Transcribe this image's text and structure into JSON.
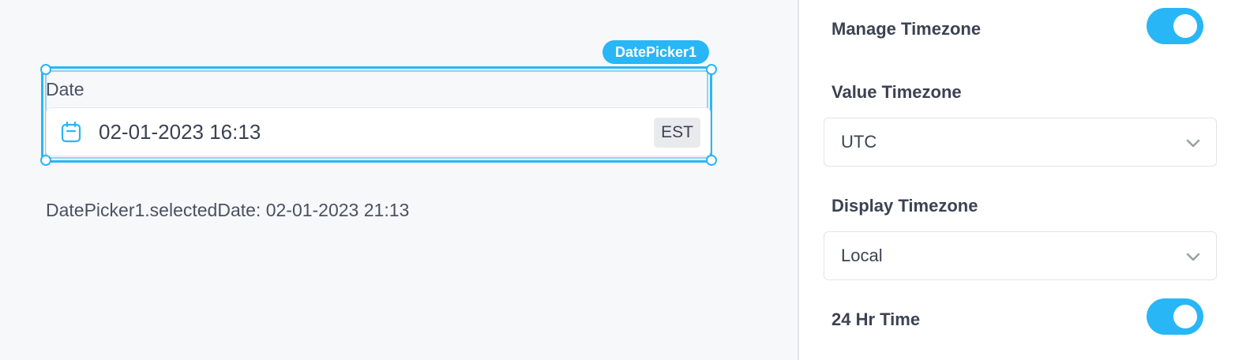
{
  "canvas": {
    "component_name": "DatePicker1",
    "date_picker": {
      "label": "Date",
      "value": "02-01-2023 16:13",
      "timezone_badge": "EST",
      "icon": "calendar-icon"
    },
    "selected_date_text": "DatePicker1.selectedDate: 02-01-2023 21:13"
  },
  "properties": {
    "manage_timezone": {
      "label": "Manage Timezone",
      "enabled": true
    },
    "value_timezone": {
      "label": "Value Timezone",
      "selected": "UTC",
      "icon": "chevron-down-icon"
    },
    "display_timezone": {
      "label": "Display Timezone",
      "selected": "Local",
      "icon": "chevron-down-icon"
    },
    "hour24_time": {
      "label": "24 Hr Time",
      "enabled": true
    }
  },
  "colors": {
    "accent": "#29b6f6",
    "canvas_bg": "#f7f8fa",
    "panel_bg": "#ffffff",
    "text": "#3b4252"
  }
}
